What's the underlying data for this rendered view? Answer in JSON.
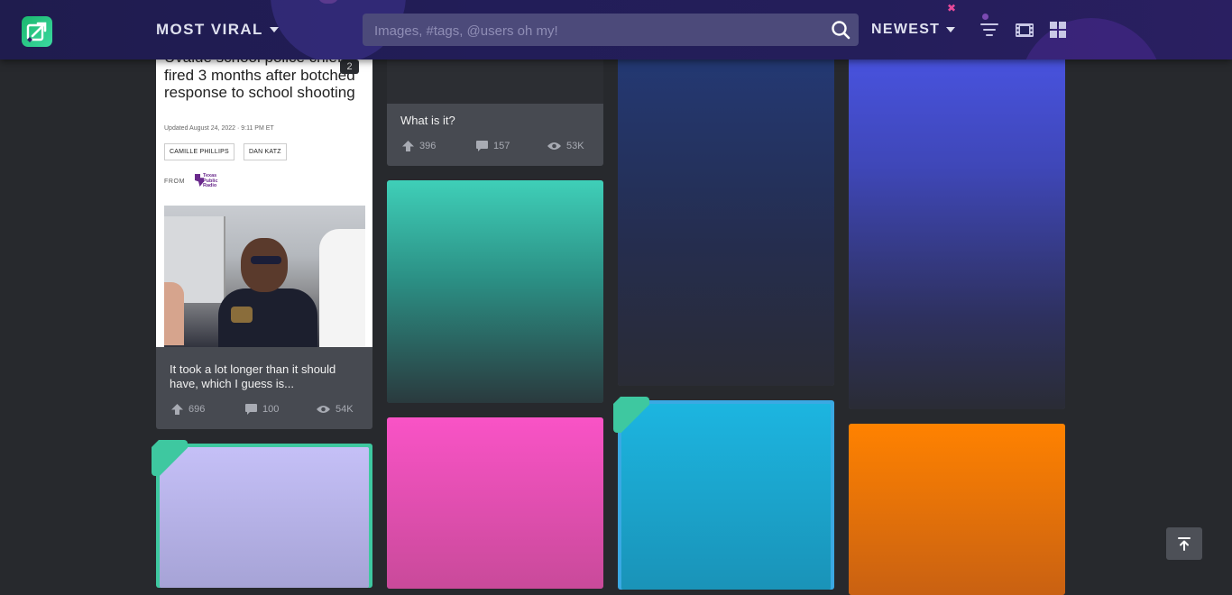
{
  "header": {
    "sort_label": "MOST VIRAL",
    "search_placeholder": "Images, #tags, @users oh my!",
    "order_label": "NEWEST"
  },
  "posts": [
    {
      "title": "It took a lot longer than it should have, which I guess is...",
      "upvotes": "696",
      "comments": "100",
      "views": "54K",
      "image_count": "2",
      "preview": {
        "headline": "Uvalde school police chief fired 3 months after botched response to school shooting",
        "updated": "Updated August 24, 2022 · 9:11 PM ET",
        "authors": [
          "CAMILLE PHILLIPS",
          "DAN KATZ"
        ],
        "from_label": "FROM",
        "source": "Texas Public Radio"
      }
    },
    {
      "title": "What is it?",
      "upvotes": "396",
      "comments": "157",
      "views": "53K"
    }
  ],
  "colors": {
    "teal": "#3fcfb8",
    "navy": "#233a78",
    "indigo": "#4a55e6",
    "lavender": "#c6bff5",
    "pink": "#f953c6",
    "cyan": "#1cb5e0",
    "orange": "#ff8200",
    "promoted": "#3ec8a0"
  },
  "icons": [
    "search-icon",
    "filter-icon",
    "film-icon",
    "grid-icon",
    "upvote-icon",
    "comment-icon",
    "eye-icon",
    "back-to-top-icon"
  ]
}
